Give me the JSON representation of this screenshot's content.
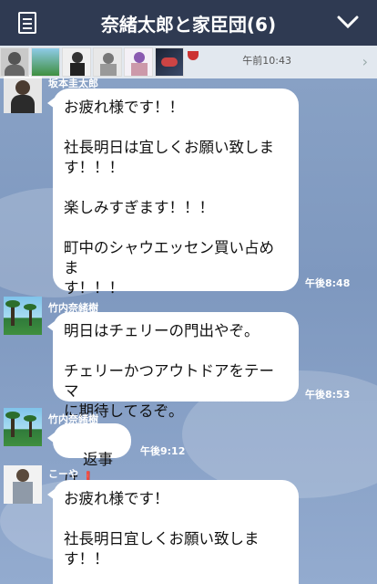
{
  "header": {
    "title": "奈緒太郎と家臣団(6)"
  },
  "members_bar": {
    "time": "午前10:43",
    "avatars": [
      "member-1",
      "member-2",
      "member-3",
      "member-4",
      "member-5",
      "member-6"
    ]
  },
  "messages": [
    {
      "sender": "坂本圭太郎",
      "text": "お疲れ様です！！\n\n社長明日は宜しくお願い致しま\nす！！！\n\n楽しみすぎます！！！\n\n町中のシャウエッセン買い占めま\nす！！！",
      "time": "午後8:48"
    },
    {
      "sender": "竹内奈緒樹",
      "text": "明日はチェリーの門出やぞ。\n\nチェリーかつアウトドアをテーマ\nに期待してるぞ。",
      "time": "午後8:53"
    },
    {
      "sender": "竹内奈緒樹",
      "text": "返事は",
      "emoji": "❗",
      "time": "午後9:12"
    },
    {
      "sender": "こーや",
      "text": "お疲れ様です！\n\n社長明日宜しくお願い致しま\nす！！\n\n楽しみにしてます！",
      "time": ""
    }
  ],
  "colors": {
    "header_bg": "#2f3a52",
    "chat_bg": "#7d95b8",
    "bubble": "#ffffff"
  }
}
